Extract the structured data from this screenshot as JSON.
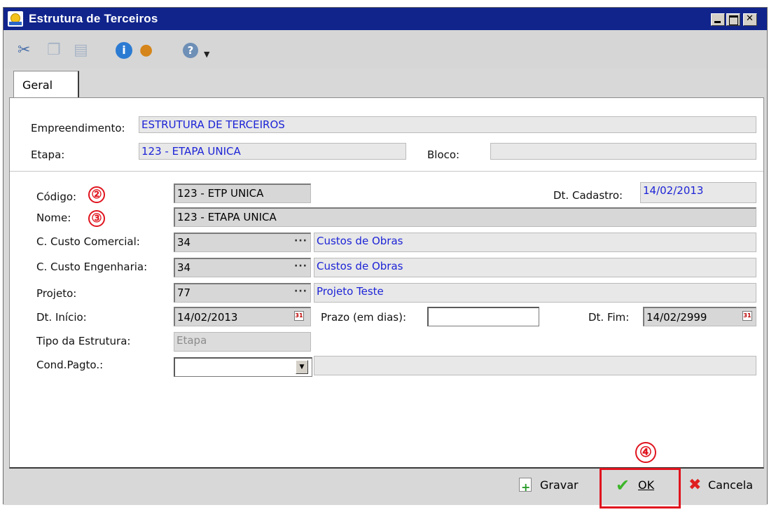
{
  "window": {
    "title": "Estrutura de Terceiros"
  },
  "toolbar": {
    "icons": [
      "cut-icon",
      "copy-icon",
      "paste-icon",
      "info-icon",
      "user-icon",
      "help-icon",
      "dropdown-arrow-icon"
    ]
  },
  "tabs": [
    {
      "label": "Geral"
    }
  ],
  "header": {
    "empreendimento_label": "Empreendimento:",
    "empreendimento_value": "ESTRUTURA DE TERCEIROS",
    "etapa_label": "Etapa:",
    "etapa_value": "123 - ETAPA UNICA",
    "bloco_label": "Bloco:",
    "bloco_value": ""
  },
  "form": {
    "codigo_label": "Código:",
    "codigo_value": "123 - ETP UNICA",
    "dt_cadastro_label": "Dt. Cadastro:",
    "dt_cadastro_value": "14/02/2013",
    "nome_label": "Nome:",
    "nome_value": "123 - ETAPA UNICA",
    "cc_comercial_label": "C. Custo Comercial:",
    "cc_comercial_code": "34",
    "cc_comercial_desc": "Custos de Obras",
    "cc_engenharia_label": "C. Custo Engenharia:",
    "cc_engenharia_code": "34",
    "cc_engenharia_desc": "Custos de Obras",
    "projeto_label": "Projeto:",
    "projeto_code": "77",
    "projeto_desc": "Projeto Teste",
    "dt_inicio_label": "Dt. Início:",
    "dt_inicio_value": "14/02/2013",
    "prazo_label": "Prazo (em dias):",
    "prazo_value": "",
    "dt_fim_label": "Dt. Fim:",
    "dt_fim_value": "14/02/2999",
    "tipo_label": "Tipo da Estrutura:",
    "tipo_value": "Etapa",
    "cond_pagto_label": "Cond.Pagto.:",
    "cond_pagto_value": "",
    "cond_pagto_desc": "",
    "lookup_dots": "···",
    "calendar_glyph": "31"
  },
  "callouts": {
    "two": "②",
    "three": "③",
    "four": "④"
  },
  "footer": {
    "gravar_label": "Gravar",
    "ok_label": "OK",
    "cancela_label": "Cancela"
  },
  "colors": {
    "titlebar": "#10248c",
    "link_blue": "#1d24d6",
    "callout_red": "#e0141e"
  }
}
